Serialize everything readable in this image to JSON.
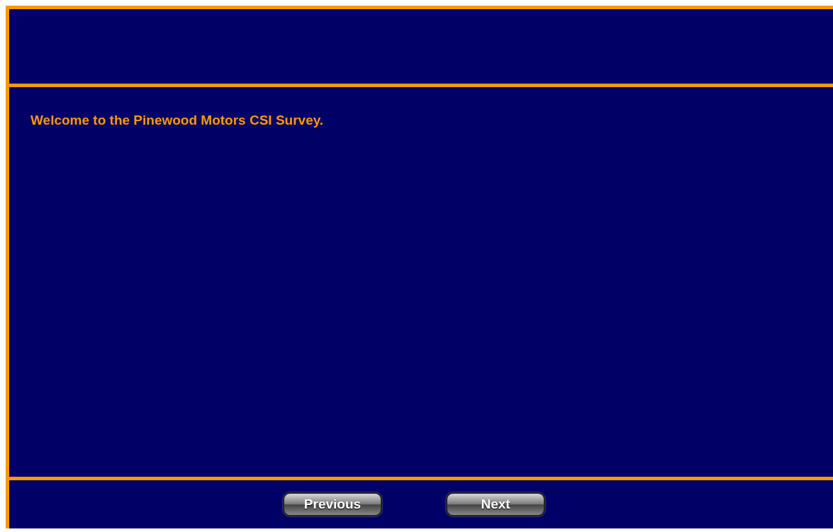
{
  "content": {
    "message": "Welcome to the Pinewood Motors CSI Survey."
  },
  "navigation": {
    "buttons": [
      {
        "label": "Previous"
      },
      {
        "label": "Next"
      }
    ]
  }
}
